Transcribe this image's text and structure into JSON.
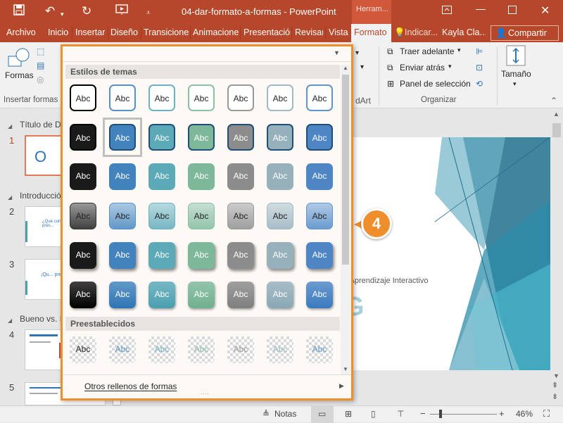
{
  "titlebar": {
    "doc_title": "04-dar-formato-a-formas - PowerPoint",
    "context_tab": "Herram...",
    "icons": [
      "save-icon",
      "undo-icon",
      "redo-icon",
      "start-slideshow-icon",
      "customize-qat-icon"
    ],
    "window_controls": [
      "ribbon-display-icon",
      "minimize-icon",
      "maximize-icon",
      "close-icon"
    ],
    "accent": "#b7472a"
  },
  "tabs": [
    {
      "label": "Archivo"
    },
    {
      "label": "Inicio"
    },
    {
      "label": "Insertar"
    },
    {
      "label": "Diseño"
    },
    {
      "label": "Transiciones"
    },
    {
      "label": "Animaciones"
    },
    {
      "label": "Presentación"
    },
    {
      "label": "Revisar"
    },
    {
      "label": "Vista"
    }
  ],
  "active_tab": "Formato",
  "tell_me": "Indicar...",
  "user": "Kayla Cla...",
  "share": "Compartir",
  "ribbon": {
    "formas_label": "Formas",
    "insertar_formas": "Insertar formas",
    "wordart_partial": "dArt",
    "traer_adelante": "Traer adelante",
    "enviar_atras": "Enviar atrás",
    "panel_seleccion": "Panel de selección",
    "organizar": "Organizar",
    "tamano": "Tamaño"
  },
  "slides_panel": {
    "sections": [
      "Título de D",
      "Introducció",
      "Bueno vs. N"
    ],
    "slide_numbers": [
      "1",
      "2",
      "3",
      "4",
      "5"
    ],
    "thumb2_text": "¿Qué curso... después de la pres...",
    "thumb3_text": "¡Qu... presentació..."
  },
  "slide": {
    "subtitle": "e Aprendizaje Interactivo",
    "big_letter": "G",
    "thumb1_letter": "O"
  },
  "gallery": {
    "section_theme": "Estilos de temas",
    "section_preset": "Preestablecidos",
    "swatch_text": "Abc",
    "footer_link": "Otros rellenos de formas",
    "theme_colors": [
      "#000000",
      "#2e75b6",
      "#4a9fb0",
      "#6fb08f",
      "#7f7f7f",
      "#8aa7b5",
      "#3a79bf"
    ],
    "rows": [
      {
        "style": "outline"
      },
      {
        "style": "solid-dark-border"
      },
      {
        "style": "solid"
      },
      {
        "style": "gradient-light"
      },
      {
        "style": "solid-shadow"
      },
      {
        "style": "intense"
      }
    ]
  },
  "callout_number": "4",
  "statusbar": {
    "notes": "Notas",
    "zoom": "46%"
  }
}
